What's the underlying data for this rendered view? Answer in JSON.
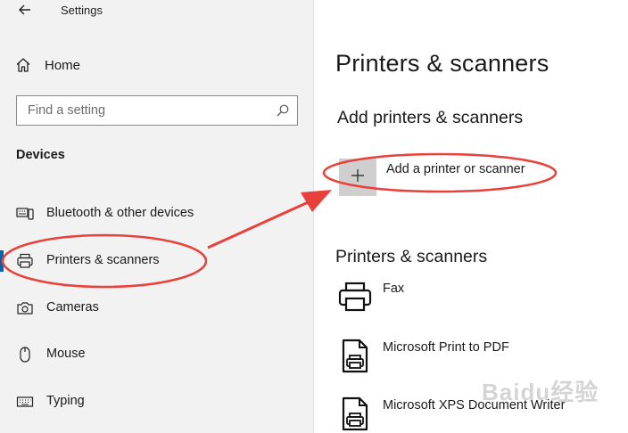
{
  "window": {
    "title": "Settings"
  },
  "sidebar": {
    "home_label": "Home",
    "search": {
      "placeholder": "Find a setting",
      "value": ""
    },
    "section_title": "Devices",
    "items": [
      {
        "label": "Bluetooth & other devices",
        "icon": "bluetooth-devices-icon",
        "selected": false
      },
      {
        "label": "Printers & scanners",
        "icon": "printer-icon",
        "selected": true
      },
      {
        "label": "Cameras",
        "icon": "camera-icon",
        "selected": false
      },
      {
        "label": "Mouse",
        "icon": "mouse-icon",
        "selected": false
      },
      {
        "label": "Typing",
        "icon": "keyboard-icon",
        "selected": false
      }
    ]
  },
  "main": {
    "title": "Printers & scanners",
    "add_section_title": "Add printers & scanners",
    "add_button_label": "Add a printer or scanner",
    "list_section_title": "Printers & scanners",
    "devices": [
      {
        "name": "Fax",
        "icon": "printer-icon"
      },
      {
        "name": "Microsoft Print to PDF",
        "icon": "document-printer-icon"
      },
      {
        "name": "Microsoft XPS Document Writer",
        "icon": "document-printer-icon"
      }
    ]
  },
  "annotation": {
    "color": "#e8403a"
  },
  "watermark": "Baidu经验",
  "colors": {
    "accent": "#0063b1",
    "sidebar_bg": "#f2f2f2",
    "add_tile": "#cfcfcf"
  }
}
